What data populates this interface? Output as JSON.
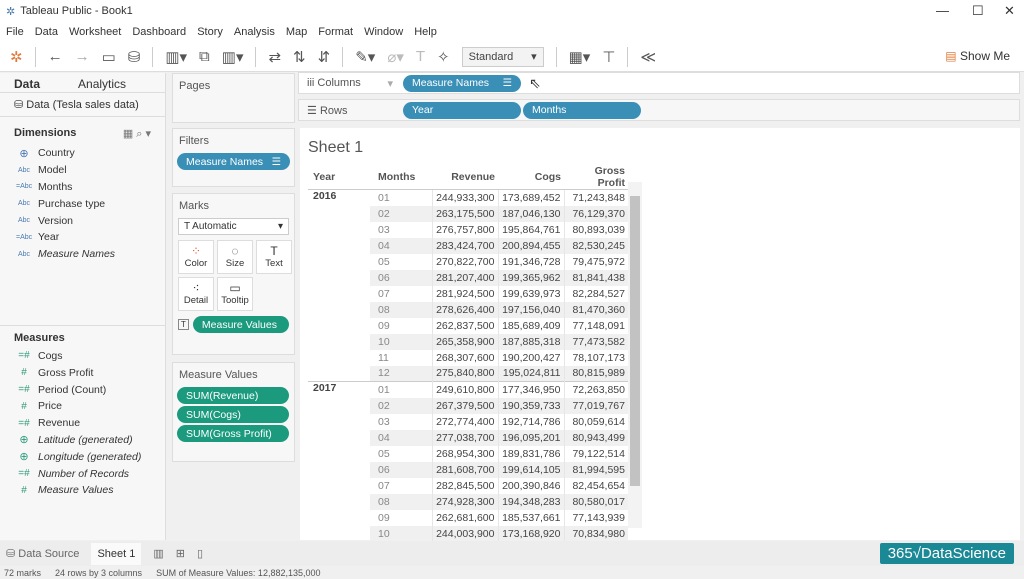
{
  "window": {
    "title": "Tableau Public - Book1"
  },
  "menu": [
    "File",
    "Data",
    "Worksheet",
    "Dashboard",
    "Story",
    "Analysis",
    "Map",
    "Format",
    "Window",
    "Help"
  ],
  "toolbar": {
    "fit": "Standard",
    "show_me": "Show Me"
  },
  "left": {
    "tabs": [
      "Data",
      "Analytics"
    ],
    "datasource": "Data (Tesla sales data)",
    "dimensions_title": "Dimensions",
    "dimensions": [
      {
        "icon": "globe",
        "label": "Country"
      },
      {
        "icon": "Abc",
        "label": "Model"
      },
      {
        "icon": "=Abc",
        "label": "Months"
      },
      {
        "icon": "Abc",
        "label": "Purchase type"
      },
      {
        "icon": "Abc",
        "label": "Version"
      },
      {
        "icon": "=Abc",
        "label": "Year"
      },
      {
        "icon": "Abc",
        "label": "Measure Names",
        "italic": true
      }
    ],
    "measures_title": "Measures",
    "measures": [
      {
        "icon": "=#",
        "label": "Cogs"
      },
      {
        "icon": "#",
        "label": "Gross Profit"
      },
      {
        "icon": "=#",
        "label": "Period (Count)"
      },
      {
        "icon": "#",
        "label": "Price"
      },
      {
        "icon": "=#",
        "label": "Revenue"
      },
      {
        "icon": "globe",
        "label": "Latitude (generated)",
        "italic": true
      },
      {
        "icon": "globe",
        "label": "Longitude (generated)",
        "italic": true
      },
      {
        "icon": "=#",
        "label": "Number of Records",
        "italic": true
      },
      {
        "icon": "#",
        "label": "Measure Values",
        "italic": true
      }
    ]
  },
  "pages": {
    "title": "Pages"
  },
  "filters": {
    "title": "Filters",
    "pill": "Measure Names"
  },
  "marks": {
    "title": "Marks",
    "type": "Automatic",
    "buttons": [
      "Color",
      "Size",
      "Text",
      "Detail",
      "Tooltip"
    ],
    "pill": "Measure Values"
  },
  "measure_values": {
    "title": "Measure Values",
    "pills": [
      "SUM(Revenue)",
      "SUM(Cogs)",
      "SUM(Gross Profit)"
    ]
  },
  "shelves": {
    "columns_label": "Columns",
    "columns": [
      "Measure Names"
    ],
    "rows_label": "Rows",
    "rows": [
      "Year",
      "Months"
    ]
  },
  "sheet": {
    "title": "Sheet 1",
    "headers": [
      "Year",
      "Months",
      "Revenue",
      "Cogs",
      "Gross Profit"
    ],
    "groups": [
      {
        "year": "2016",
        "rows": [
          [
            "01",
            "244,933,300",
            "173,689,452",
            "71,243,848"
          ],
          [
            "02",
            "263,175,500",
            "187,046,130",
            "76,129,370"
          ],
          [
            "03",
            "276,757,800",
            "195,864,761",
            "80,893,039"
          ],
          [
            "04",
            "283,424,700",
            "200,894,455",
            "82,530,245"
          ],
          [
            "05",
            "270,822,700",
            "191,346,728",
            "79,475,972"
          ],
          [
            "06",
            "281,207,400",
            "199,365,962",
            "81,841,438"
          ],
          [
            "07",
            "281,924,500",
            "199,639,973",
            "82,284,527"
          ],
          [
            "08",
            "278,626,400",
            "197,156,040",
            "81,470,360"
          ],
          [
            "09",
            "262,837,500",
            "185,689,409",
            "77,148,091"
          ],
          [
            "10",
            "265,358,900",
            "187,885,318",
            "77,473,582"
          ],
          [
            "11",
            "268,307,600",
            "190,200,427",
            "78,107,173"
          ],
          [
            "12",
            "275,840,800",
            "195,024,811",
            "80,815,989"
          ]
        ]
      },
      {
        "year": "2017",
        "rows": [
          [
            "01",
            "249,610,800",
            "177,346,950",
            "72,263,850"
          ],
          [
            "02",
            "267,379,500",
            "190,359,733",
            "77,019,767"
          ],
          [
            "03",
            "272,774,400",
            "192,714,786",
            "80,059,614"
          ],
          [
            "04",
            "277,038,700",
            "196,095,201",
            "80,943,499"
          ],
          [
            "05",
            "268,954,300",
            "189,831,786",
            "79,122,514"
          ],
          [
            "06",
            "281,608,700",
            "199,614,105",
            "81,994,595"
          ],
          [
            "07",
            "282,845,500",
            "200,390,846",
            "82,454,654"
          ],
          [
            "08",
            "274,928,300",
            "194,348,283",
            "80,580,017"
          ],
          [
            "09",
            "262,681,600",
            "185,537,661",
            "77,143,939"
          ],
          [
            "10",
            "244,003,900",
            "173,168,920",
            "70,834,980"
          ]
        ]
      }
    ]
  },
  "bottom": {
    "data_source": "Data Source",
    "sheet_tab": "Sheet 1",
    "logo": "365√DataScience"
  },
  "status": {
    "marks": "72 marks",
    "dims": "24 rows by 3 columns",
    "sum": "SUM of Measure Values: 12,882,135,000"
  },
  "colors": {
    "dimension_pill": "#3a8fb7",
    "measure_pill": "#1b9a7e",
    "logo": "#1b8896"
  }
}
